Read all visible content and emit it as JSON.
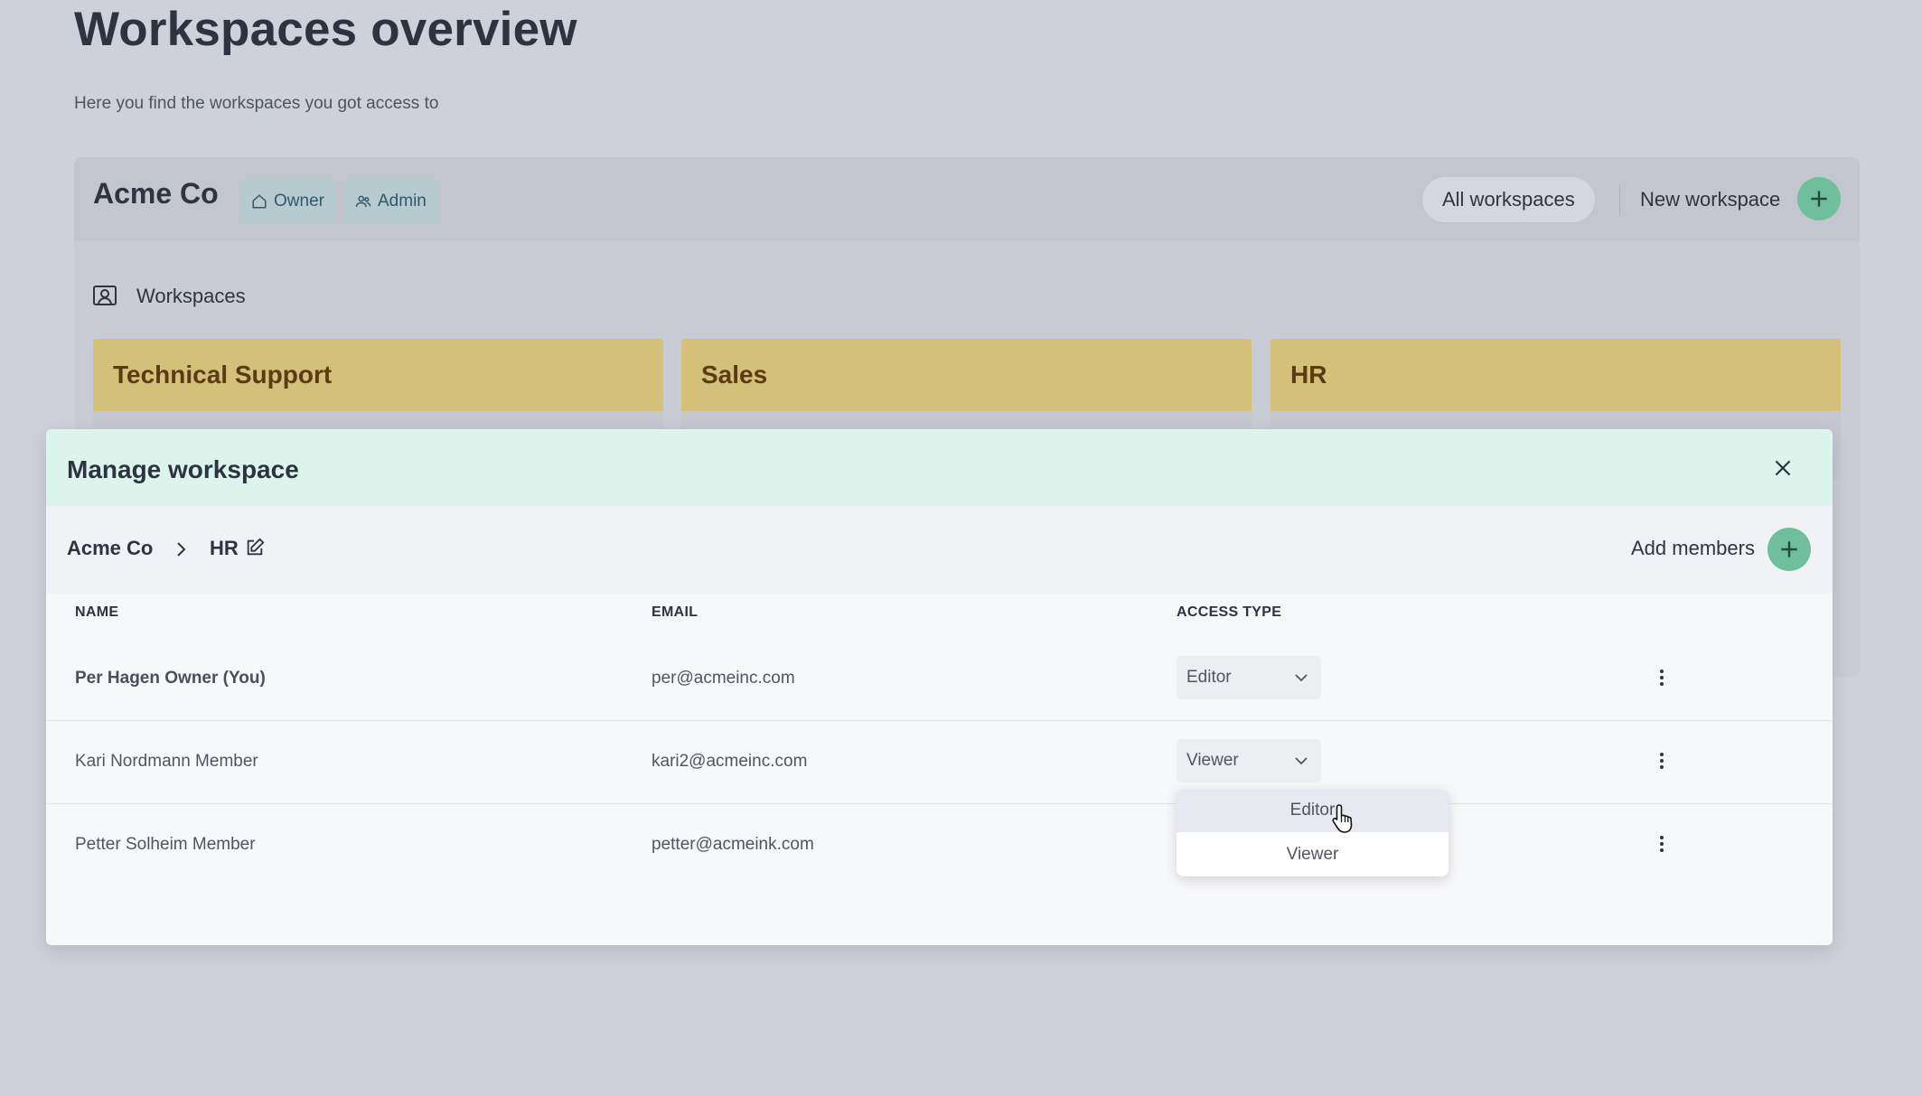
{
  "page": {
    "title": "Workspaces overview",
    "subtitle": "Here you find the workspaces you got access to"
  },
  "org": {
    "name": "Acme Co",
    "badges": [
      "Owner",
      "Admin"
    ],
    "all_workspaces_label": "All workspaces",
    "new_workspace_label": "New workspace",
    "section_label": "Workspaces",
    "tiles": [
      "Technical Support",
      "Sales",
      "HR"
    ],
    "tile_color": "#d3c17a"
  },
  "modal": {
    "title": "Manage workspace",
    "breadcrumb": {
      "org": "Acme Co",
      "workspace": "HR"
    },
    "add_members_label": "Add members",
    "columns": {
      "name": "NAME",
      "email": "EMAIL",
      "access": "ACCESS TYPE"
    },
    "rows": [
      {
        "name": "Per Hagen Owner (You)",
        "email": "per@acmeinc.com",
        "access": "Editor"
      },
      {
        "name": "Kari Nordmann Member",
        "email": "kari2@acmeinc.com",
        "access": "Viewer"
      },
      {
        "name": "Petter Solheim Member",
        "email": "petter@acmeink.com",
        "access": ""
      }
    ],
    "dropdown_options": [
      "Editor",
      "Viewer"
    ],
    "header_color": "#dcf5ec",
    "accent_color": "#6fbf9c"
  }
}
